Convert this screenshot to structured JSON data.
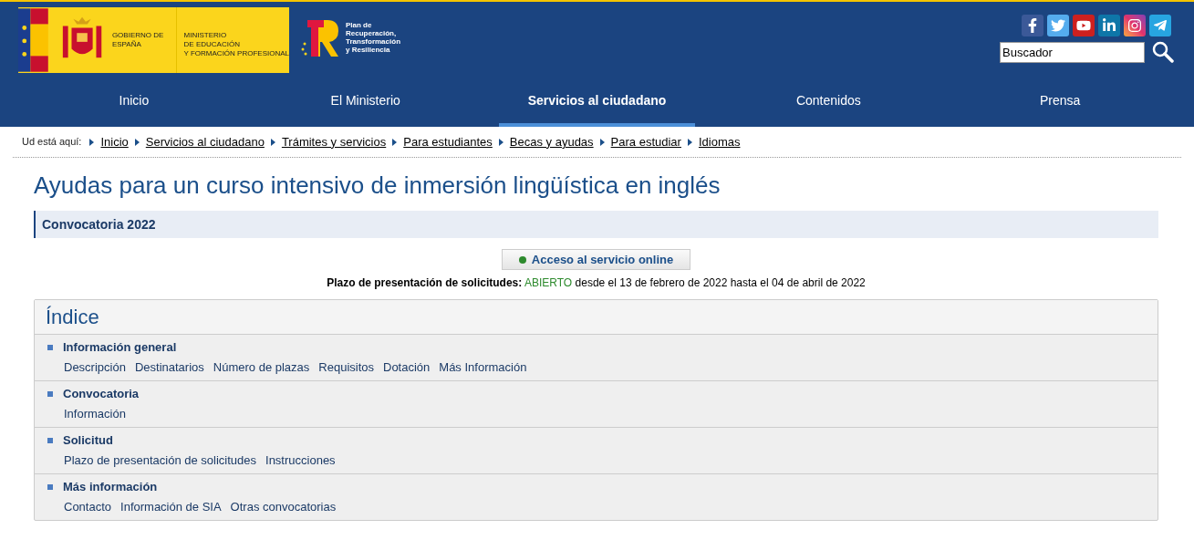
{
  "header": {
    "logo_gobierno": "GOBIERNO DE ESPAÑA",
    "logo_ministerio": [
      "MINISTERIO",
      "DE EDUCACIÓN",
      "Y FORMACIÓN PROFESIONAL"
    ],
    "logo_plan": [
      "Plan de",
      "Recuperación,",
      "Transformación",
      "y Resiliencia"
    ],
    "search": {
      "value": "Buscador"
    }
  },
  "nav": [
    {
      "label": "Inicio",
      "selected": false
    },
    {
      "label": "El Ministerio",
      "selected": false
    },
    {
      "label": "Servicios al ciudadano",
      "selected": true
    },
    {
      "label": "Contenidos",
      "selected": false
    },
    {
      "label": "Prensa",
      "selected": false
    }
  ],
  "breadcrumb": {
    "label": "Ud está aquí:",
    "items": [
      "Inicio",
      "Servicios al ciudadano",
      "Trámites y servicios",
      "Para estudiantes",
      "Becas y ayudas",
      "Para estudiar",
      "Idiomas"
    ]
  },
  "title": "Ayudas para un curso intensivo de inmersión lingüística en inglés",
  "subtitle": "Convocatoria 2022",
  "online_button": "Acceso al servicio online",
  "deadline": {
    "label": "Plazo de presentación de solicitudes:",
    "status": "ABIERTO",
    "range": "desde el 13 de febrero de 2022 hasta el 04 de abril de 2022"
  },
  "index": {
    "title": "Índice",
    "sections": [
      {
        "heading": "Información general",
        "links": [
          "Descripción",
          "Destinatarios",
          "Número de plazas",
          "Requisitos",
          "Dotación",
          "Más Información"
        ]
      },
      {
        "heading": "Convocatoria",
        "links": [
          "Información"
        ]
      },
      {
        "heading": "Solicitud",
        "links": [
          "Plazo de presentación de solicitudes",
          "Instrucciones"
        ]
      },
      {
        "heading": "Más información",
        "links": [
          "Contacto",
          "Información de SIA",
          "Otras convocatorias"
        ]
      }
    ]
  }
}
